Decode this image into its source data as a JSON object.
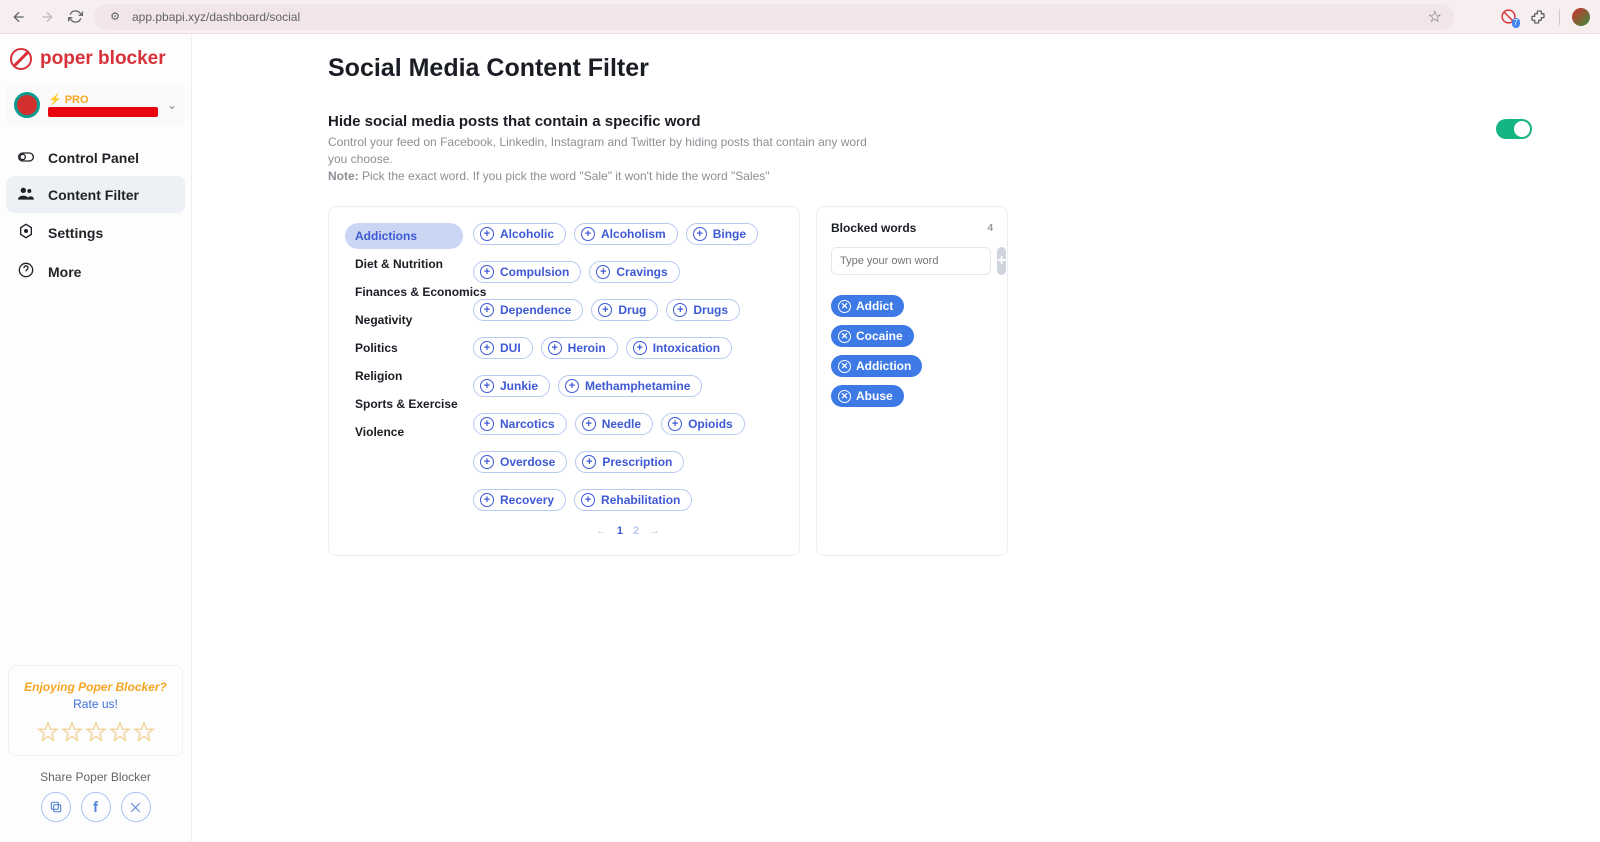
{
  "browser": {
    "url": "app.pbapi.xyz/dashboard/social"
  },
  "brand": "poper blocker",
  "account": {
    "plan": "PRO"
  },
  "nav": {
    "control_panel": "Control Panel",
    "content_filter": "Content Filter",
    "settings": "Settings",
    "more": "More"
  },
  "rate": {
    "title": "Enjoying Poper Blocker?",
    "sub": "Rate us!"
  },
  "share_label": "Share Poper Blocker",
  "page_title": "Social Media Content Filter",
  "section": {
    "title": "Hide social media posts that contain a specific word",
    "desc": "Control your feed on Facebook, Linkedin, Instagram and Twitter by hiding posts that contain any word you choose.",
    "note_label": "Note:",
    "note_text": " Pick the exact word. If you pick the word \"Sale\" it won't hide the word \"Sales\""
  },
  "categories": [
    "Addictions",
    "Diet & Nutrition",
    "Finances & Economics",
    "Negativity",
    "Politics",
    "Religion",
    "Sports & Exercise",
    "Violence"
  ],
  "active_category_index": 0,
  "tags": [
    "Alcoholic",
    "Alcoholism",
    "Binge",
    "Compulsion",
    "Cravings",
    "Dependence",
    "Drug",
    "Drugs",
    "DUI",
    "Heroin",
    "Intoxication",
    "Junkie",
    "Methamphetamine",
    "Narcotics",
    "Needle",
    "Opioids",
    "Overdose",
    "Prescription",
    "Recovery",
    "Rehabilitation"
  ],
  "pager": {
    "current": "1",
    "other": "2"
  },
  "blocked": {
    "label": "Blocked words",
    "count": "4",
    "placeholder": "Type your own word",
    "words": [
      "Addict",
      "Cocaine",
      "Addiction",
      "Abuse"
    ]
  }
}
